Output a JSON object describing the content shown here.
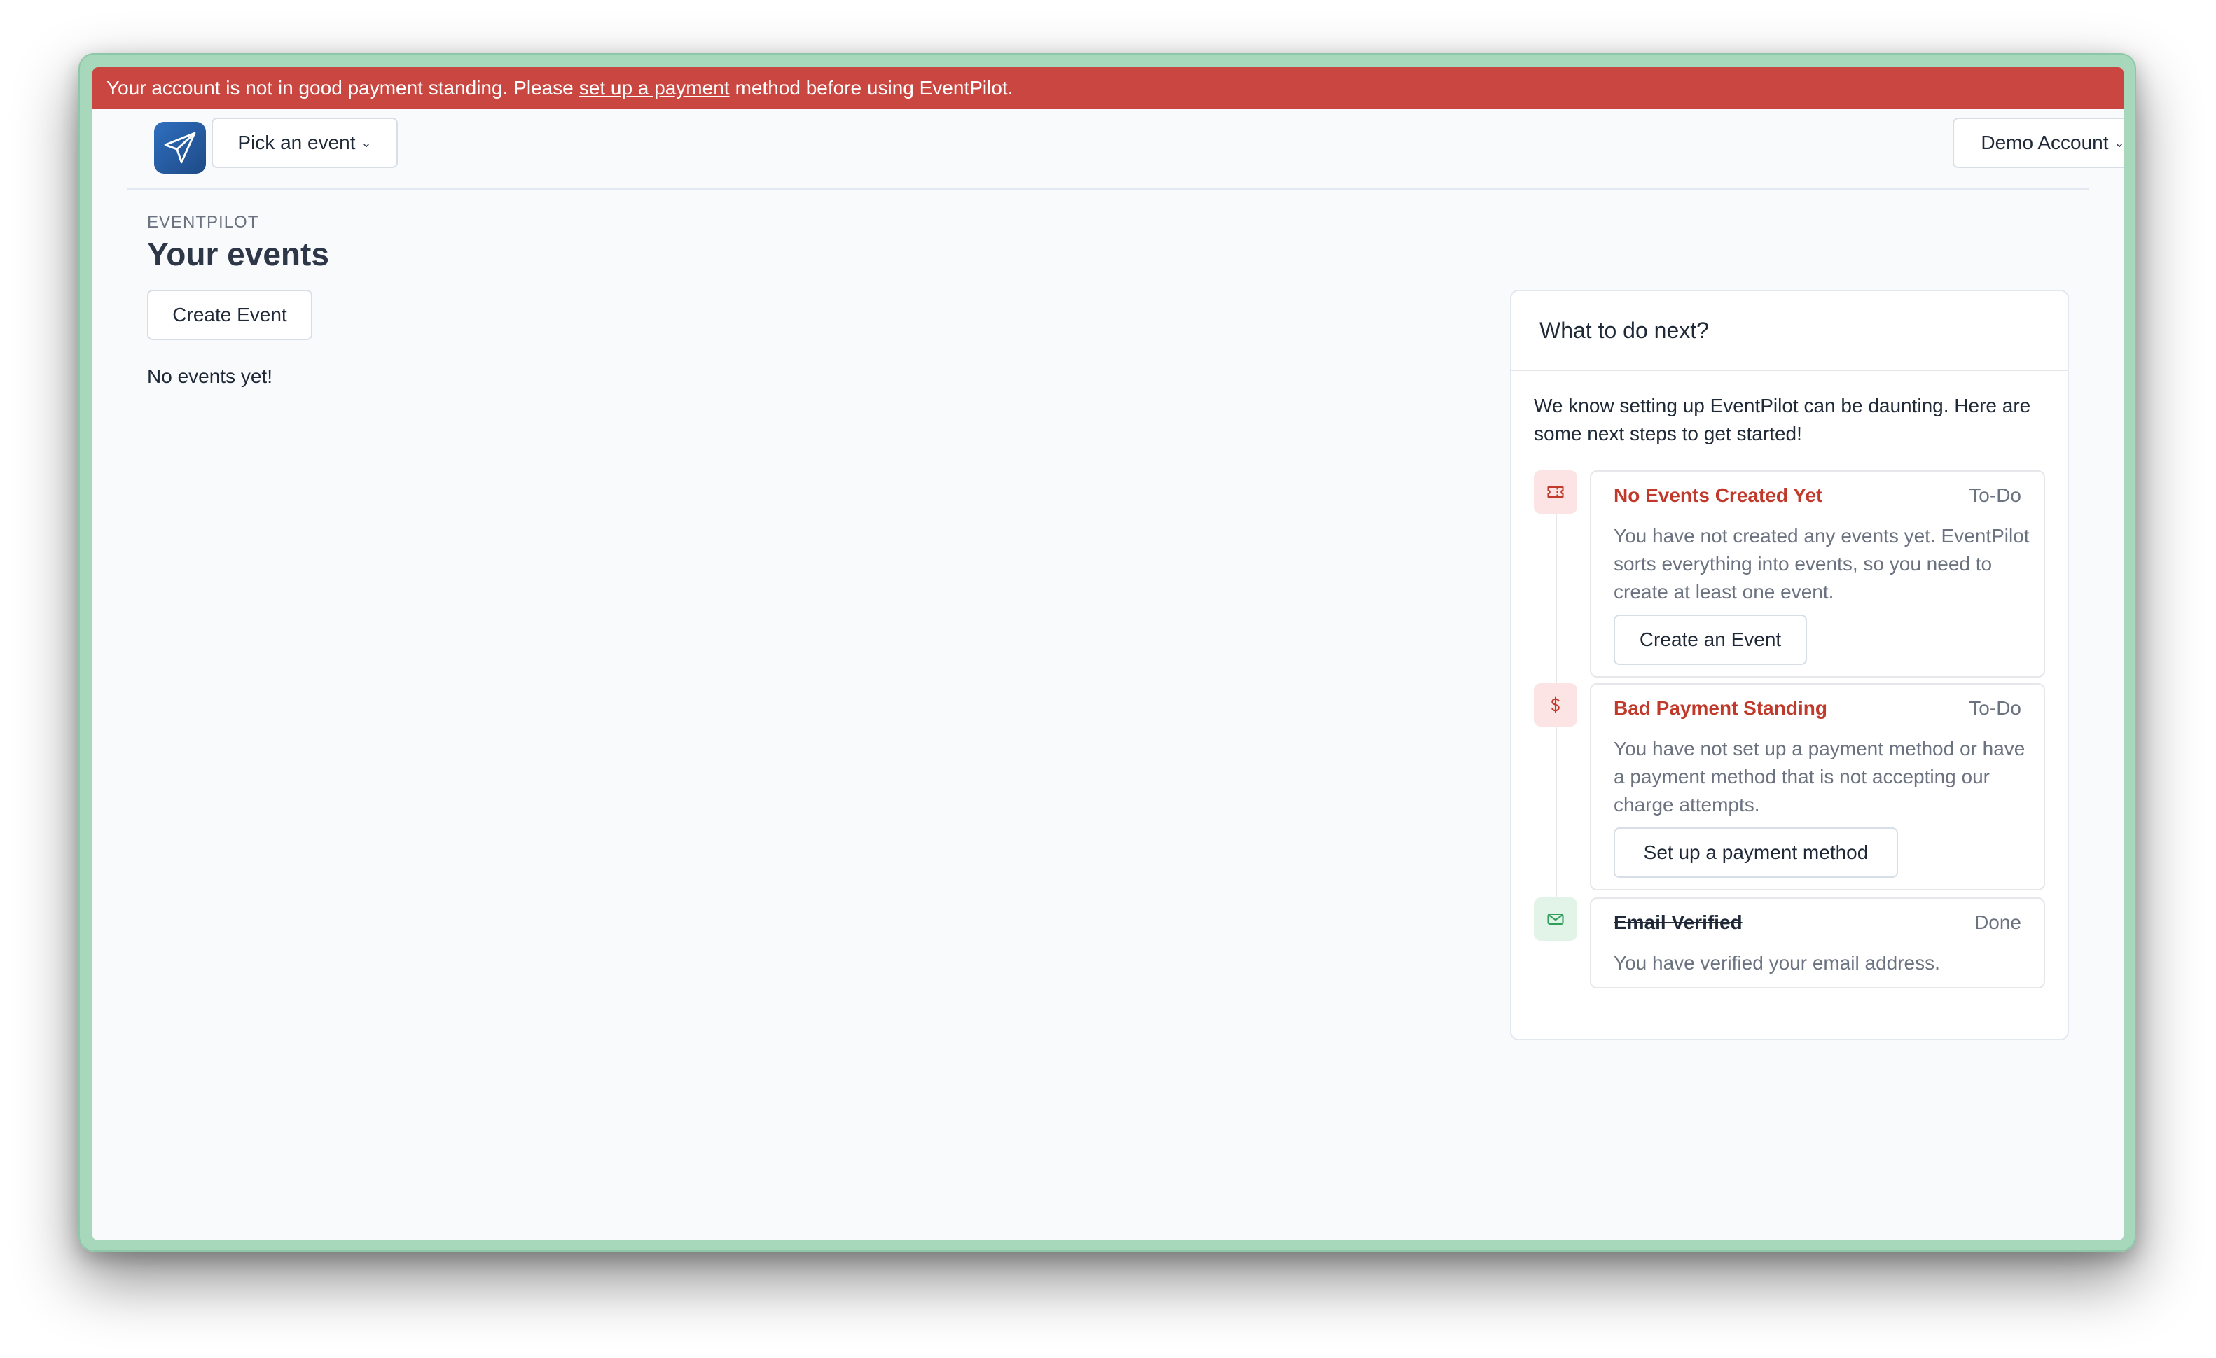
{
  "banner": {
    "text_before": "Your account is not in good payment standing. Please",
    "link": "set up a payment",
    "text_after": "method before using EventPilot."
  },
  "header": {
    "logo_icon": "paper-plane-icon",
    "event_picker_label": "Pick an event",
    "account_label": "Demo Account",
    "chevron_icon": "chevron-down-icon"
  },
  "main": {
    "eyebrow": "EVENTPILOT",
    "title": "Your events",
    "create_button": "Create Event",
    "empty_text": "No events yet!"
  },
  "next_steps": {
    "title": "What to do next?",
    "intro": "We know setting up EventPilot can be daunting. Here are some next steps to get started!",
    "steps": [
      {
        "icon": "ticket-icon",
        "title": "No Events Created Yet",
        "status": "To-Do",
        "description": "You have not created any events yet. EventPilot sorts everything into events, so you need to create at least one event.",
        "action": "Create an Event",
        "color": "#c0392b"
      },
      {
        "icon": "dollar-icon",
        "title": "Bad Payment Standing",
        "status": "To-Do",
        "description": "You have not set up a payment method or have a payment method that is not accepting our charge attempts.",
        "action": "Set up a payment method",
        "color": "#c0392b"
      },
      {
        "icon": "mail-icon",
        "title": "Email Verified",
        "status": "Done",
        "description": "You have verified your email address.",
        "color": "#2f9e5b"
      }
    ]
  },
  "colors": {
    "banner": "#c94641",
    "window_frame": "#a7d8bc",
    "app_background": "#f8fafc",
    "todo_accent": "#c0392b",
    "done_accent": "#2f9e5b"
  }
}
